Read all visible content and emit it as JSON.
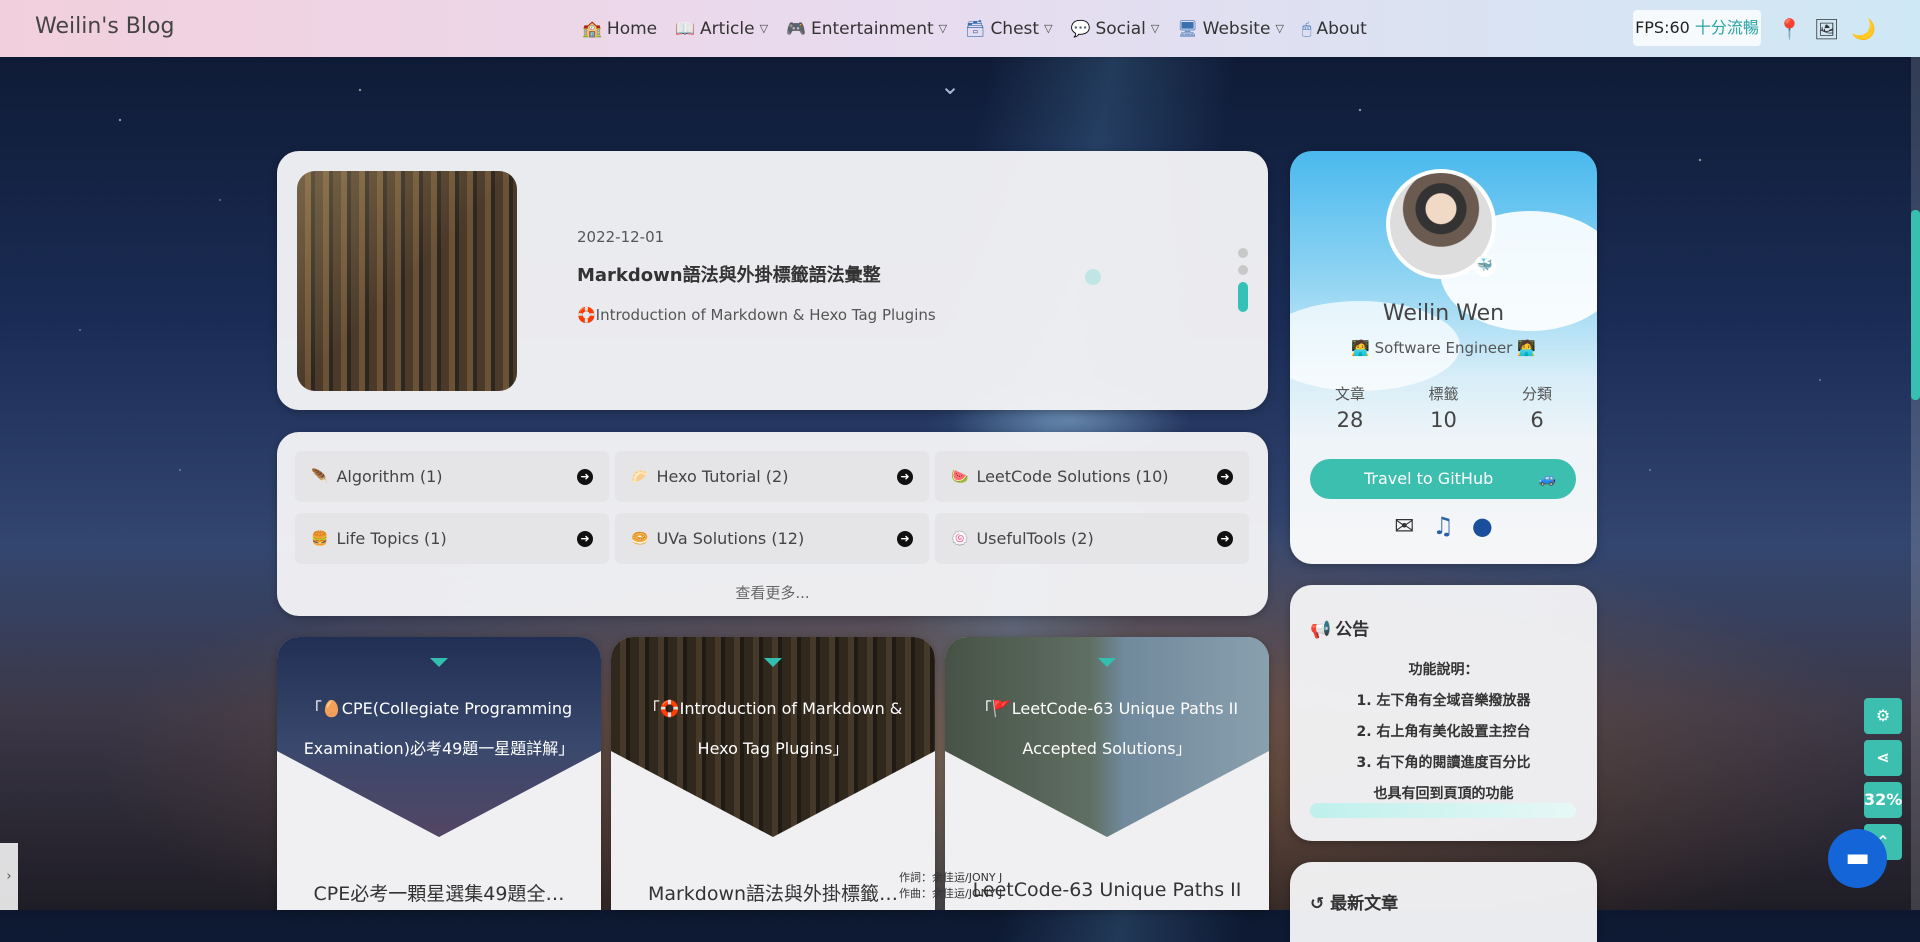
{
  "nav": {
    "brand": "Weilin's Blog",
    "items": [
      {
        "label": "Home",
        "icon": "🏫",
        "has_menu": false
      },
      {
        "label": "Article",
        "icon": "📖",
        "has_menu": true
      },
      {
        "label": "Entertainment",
        "icon": "🎮",
        "has_menu": true
      },
      {
        "label": "Chest",
        "icon": "🗃",
        "has_menu": true
      },
      {
        "label": "Social",
        "icon": "💬",
        "has_menu": true
      },
      {
        "label": "Website",
        "icon": "🖥",
        "has_menu": true
      },
      {
        "label": "About",
        "icon": "🖱",
        "has_menu": false
      }
    ],
    "fps_label": "FPS:60",
    "fps_status": "十分流暢"
  },
  "featured": {
    "date": "2022-12-01",
    "title": "Markdown語法與外掛標籤語法彙整",
    "subtitle": "🛟Introduction of Markdown & Hexo Tag Plugins"
  },
  "categories": [
    {
      "label": "Algorithm (1)",
      "icon": "🪶"
    },
    {
      "label": "Hexo Tutorial (2)",
      "icon": "🥟"
    },
    {
      "label": "LeetCode Solutions (10)",
      "icon": "🍉"
    },
    {
      "label": "Life Topics (1)",
      "icon": "🍔"
    },
    {
      "label": "UVa Solutions (12)",
      "icon": "🥯"
    },
    {
      "label": "UsefulTools (2)",
      "icon": "🍥"
    }
  ],
  "categories_more": "查看更多...",
  "posts": [
    {
      "overlay": "「🥚CPE(Collegiate Programming Examination)必考49題一星題詳解」",
      "title": "CPE必考一顆星選集49題全…"
    },
    {
      "overlay": "「🛟Introduction of Markdown & Hexo Tag Plugins」",
      "title": "Markdown語法與外掛標籤…"
    },
    {
      "overlay": "「🚩LeetCode-63 Unique Paths II Accepted Solutions」",
      "title": "LeetCode-63 Unique Paths II"
    }
  ],
  "profile": {
    "name": "Weilin Wen",
    "role": "🧑‍💻 Software Engineer 🧑‍💻",
    "stats": [
      {
        "label": "文章",
        "value": "28"
      },
      {
        "label": "標籤",
        "value": "10"
      },
      {
        "label": "分類",
        "value": "6"
      }
    ],
    "github_button": "Travel to GitHub"
  },
  "announcement": {
    "title": "公告",
    "lines": [
      "功能說明：",
      "1. 左下角有全域音樂撥放器",
      "2. 右上角有美化設置主控台",
      "3. 右下角的閱讀進度百分比",
      "也具有回到頁頂的功能"
    ]
  },
  "recent": {
    "title": "最新文章"
  },
  "tools": {
    "progress": "32%"
  },
  "lyrics": [
    "作詞：余佳运/JONY J",
    "作曲：余佳运/JONY J"
  ],
  "colors": {
    "accent": "#3cbfae",
    "navbar_start": "#f2cfdc",
    "navbar_end": "#cfe8f5"
  }
}
